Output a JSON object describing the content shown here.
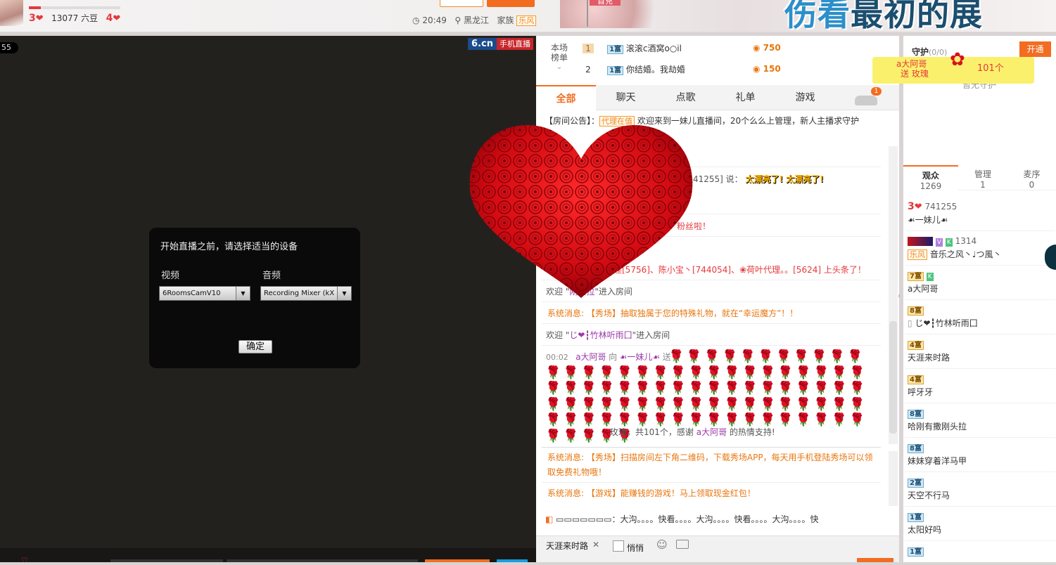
{
  "header": {
    "level_left": "3",
    "level_right": "4",
    "level_progress": 0.13,
    "beans": "13077 六豆",
    "time": "20:49",
    "location": "黑龙江",
    "family_label": "家族",
    "family_tag": "乐风",
    "banner_text_a": "伤看",
    "banner_text_b": "最初的展",
    "first_tag": "首充"
  },
  "video": {
    "timer": "55",
    "logo_brand": "6.cn",
    "logo_sub": "手机直播"
  },
  "dialog": {
    "title": "开始直播之前，请选择适当的设备",
    "video_label": "视频",
    "audio_label": "音频",
    "video_device": "6RoomsCamV10",
    "audio_device": "Recording Mixer (kX",
    "ok_label": "确定"
  },
  "ranking": {
    "tag_line1": "本场",
    "tag_line2": "榜单",
    "rows": [
      {
        "rank": "1",
        "badge": "1富",
        "name": "滚滚c酒窝o○il",
        "amount": "750"
      },
      {
        "rank": "2",
        "badge": "1富",
        "name": "你结婚。我劫婚",
        "amount": "150"
      }
    ]
  },
  "tabs": [
    "全部",
    "聊天",
    "点歌",
    "礼单",
    "游戏"
  ],
  "car_badge": "1",
  "chat": {
    "notice_prefix": "【房间公告】：",
    "notice_tag": "代理在值",
    "notice_text": "欢迎来到一妹儿直播间，20个么么上管理，新人主播求守护",
    "msg1": "&@",
    "msg2_id": "41255] 说：",
    "msg2_text": "太漂亮了!    太漂亮了!",
    "msg3": "粉丝啦！",
    "msg4": "莲[5756]、陈小宝丶[744054]、❀荷叶代理。。[5624] 上头条了！",
    "msg5_prefix": "欢迎",
    "msg5_name": "刚头拉",
    "msg5_suffix": "进入房间",
    "sys1_prefix": "系统消息:",
    "sys1_text": "【秀场】抽取独属于您的特殊礼物，就在“幸运魔方”！！",
    "msg6_prefix": "欢迎",
    "msg6_name": "じ❤┇竹林听雨囗",
    "msg6_suffix": "进入房间",
    "gift_time": "00:02",
    "gift_sender": "a大阿哥",
    "gift_to": "向",
    "gift_receiver": "☙一妹儿☙",
    "gift_send": "送",
    "gift_roses": "🌹🌹🌹🌹🌹🌹🌹🌹🌹🌹🌹🌹🌹🌹🌹🌹🌹🌹🌹🌹🌹🌹🌹🌹🌹🌹🌹🌹🌹🌹🌹🌹🌹🌹🌹🌹🌹🌹🌹🌹🌹🌹🌹🌹🌹🌹🌹🌹🌹🌹🌹🌹🌹🌹🌹🌹🌹🌹🌹🌹🌹🌹🌹🌹🌹🌹🌹🌹🌹🌹🌹🌹🌹🌹🌹🌹🌹🌹🌹🌹🌹🌹🌹🌹🌹🌹🌹🌹",
    "gift_tail_1": "玫瑰，共101个，感谢",
    "gift_tail_name": "a大阿哥",
    "gift_tail_2": "的热情支持!",
    "sys2_prefix": "系统消息:",
    "sys2_text": "【秀场】扫描房间左下角二维码，下载秀场APP，每天用手机登陆秀场可以领",
    "sys2_text2": "取免费礼物哦！",
    "sys3_prefix": "系统消息:",
    "sys3_text": "【游戏】能赚钱的游戏！马上领取现金红包！",
    "broadcast": "▭▭▭▭▭▭▭：大沟。。。。快看。。。。大沟。。。。快看。。。。大沟。。。。快"
  },
  "input": {
    "target_name": "天涯来时路",
    "close": "✕",
    "quiet_label": "悄悄"
  },
  "guard": {
    "title": "守护",
    "count": "(0/0)",
    "open_label": "开通",
    "empty_text": "暂无守护",
    "popup_name": "a大阿哥",
    "popup_action": "送 玫瑰",
    "popup_count": "101个"
  },
  "audience_tabs": [
    {
      "label": "观众",
      "count": "1269"
    },
    {
      "label": "管理",
      "count": "1"
    },
    {
      "label": "麦序",
      "count": "0"
    }
  ],
  "audience": [
    {
      "badge": "3",
      "id": "741255",
      "name": "☙一妹儿☙"
    },
    {
      "badge": "V K",
      "id": "1314",
      "tag": "乐风",
      "name": "音乐之风丶♩つ風丶"
    },
    {
      "badge": "7富",
      "name": "a大阿哥"
    },
    {
      "badge": "8富",
      "name": "じ❤┇竹林听雨囗"
    },
    {
      "badge": "4富",
      "name": "天涯来时路"
    },
    {
      "badge": "4富",
      "name": "呼牙牙"
    },
    {
      "badge": "8富",
      "name": "哈刚有撒刚头拉"
    },
    {
      "badge": "8富",
      "name": "妹妹穿着洋马甲"
    },
    {
      "badge": "2富",
      "name": "天空不行马"
    },
    {
      "badge": "1富",
      "name": "太阳好吗"
    },
    {
      "badge": "1富",
      "name": ""
    }
  ],
  "colors": {
    "accent": "#f26d21",
    "heart": "#e4393c",
    "gold": "#e8760e",
    "video_bg": "#23211e"
  }
}
